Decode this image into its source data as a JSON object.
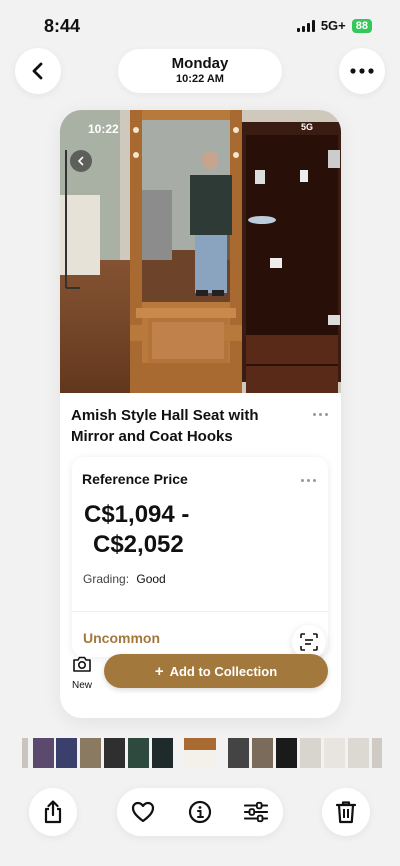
{
  "status_bar": {
    "time": "8:44",
    "network": "5G+",
    "battery": "88"
  },
  "header": {
    "day": "Monday",
    "time": "10:22 AM"
  },
  "photo": {
    "inner_time": "10:22",
    "inner_status": "5G"
  },
  "item": {
    "title": "Amish Style Hall Seat with Mirror and Coat Hooks"
  },
  "reference": {
    "label": "Reference Price",
    "price_line1": "C$1,094 -",
    "price_line2": "C$2,052",
    "grading_label": "Grading:",
    "grading_value": "Good",
    "rarity": "Uncommon"
  },
  "actions": {
    "new_label": "New",
    "add_label": "Add to Collection"
  },
  "colors": {
    "accent": "#a3783d",
    "battery": "#34c759",
    "background": "#f2f2f2"
  },
  "icons": [
    "chevron-left-icon",
    "more-horizontal-icon",
    "scan-text-icon",
    "camera-icon",
    "plus-icon",
    "share-icon",
    "heart-icon",
    "info-icon",
    "sliders-icon",
    "trash-icon"
  ]
}
